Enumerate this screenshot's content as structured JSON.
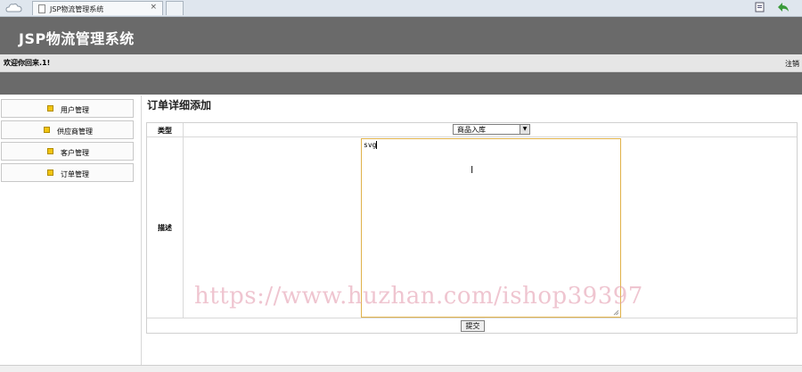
{
  "browser": {
    "tab_title": "JSP物流管理系统",
    "tab_close": "×"
  },
  "header": {
    "title": "JSP物流管理系统",
    "welcome": "欢迎你回来.1!",
    "logout": "注销"
  },
  "sidebar": {
    "items": [
      {
        "label": "用户管理"
      },
      {
        "label": "供应商管理"
      },
      {
        "label": "客户管理"
      },
      {
        "label": "订单管理"
      }
    ]
  },
  "main": {
    "title": "订单详细添加",
    "type_label": "类型",
    "type_value": "商品入库",
    "desc_label": "描述",
    "desc_value": "svg",
    "submit_label": "提交"
  },
  "watermark": "https://www.huzhan.com/ishop39397",
  "colors": {
    "header_bg": "#6a6a6a",
    "textarea_border": "#e0b24a"
  }
}
